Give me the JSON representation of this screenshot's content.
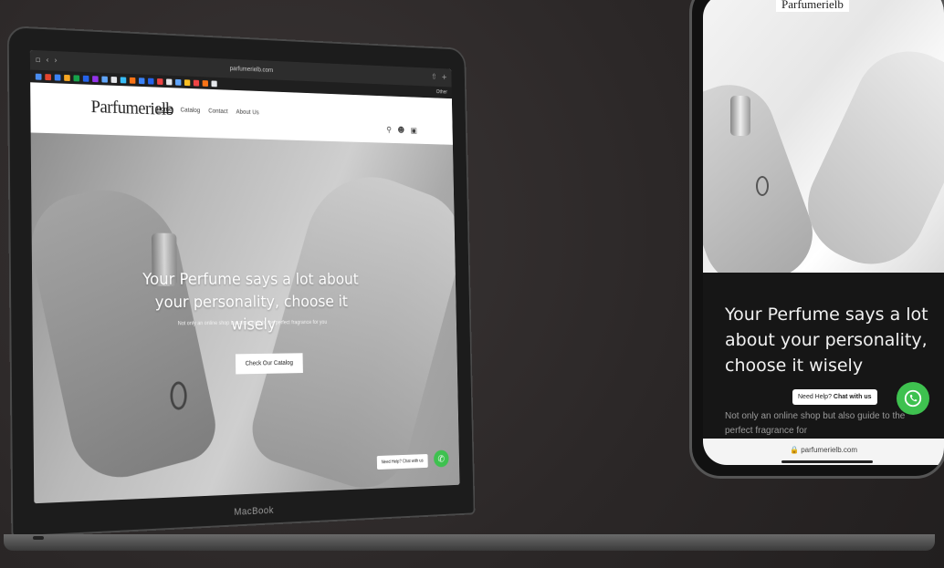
{
  "laptop": {
    "device_label": "MacBook",
    "browser": {
      "tab_title": "parfumerielb.com",
      "bookmarks_colors": [
        "#4a8df0",
        "#e2442f",
        "#3b82f6",
        "#f5a623",
        "#16a34a",
        "#2563eb",
        "#9333ea",
        "#60a5fa",
        "#e5e7eb",
        "#38bdf8",
        "#f97316",
        "#3b82f6",
        "#2563eb",
        "#ef4444",
        "#e5e7eb",
        "#60a5fa",
        "#fbbf24",
        "#ef4444",
        "#f97316",
        "#e5e7eb"
      ],
      "bookmarks_more": "Other"
    },
    "site": {
      "logo": "Parfumerielb",
      "nav": [
        "Home",
        "Catalog",
        "Contact",
        "About Us"
      ],
      "header_icons": [
        "search-icon",
        "user-icon",
        "cart-icon"
      ],
      "hero_title": "Your Perfume says a lot about your personality, choose it wisely",
      "hero_subtitle": "Not only an online shop but also guide to the perfect fragrance for you",
      "cta_label": "Check Our Catalog",
      "chat_label": "Need Help? Chat with us"
    }
  },
  "phone": {
    "brand": "Parfumerielb",
    "hero_title": "Your Perfume says a lot about your personality, choose it wisely",
    "hero_subtitle": "Not only an online shop but also guide to the perfect fragrance for",
    "chat_prefix": "Need Help?",
    "chat_bold": "Chat with us",
    "url": "parfumerielb.com"
  },
  "colors": {
    "whatsapp": "#3ec14f",
    "background": "#2b2727"
  }
}
